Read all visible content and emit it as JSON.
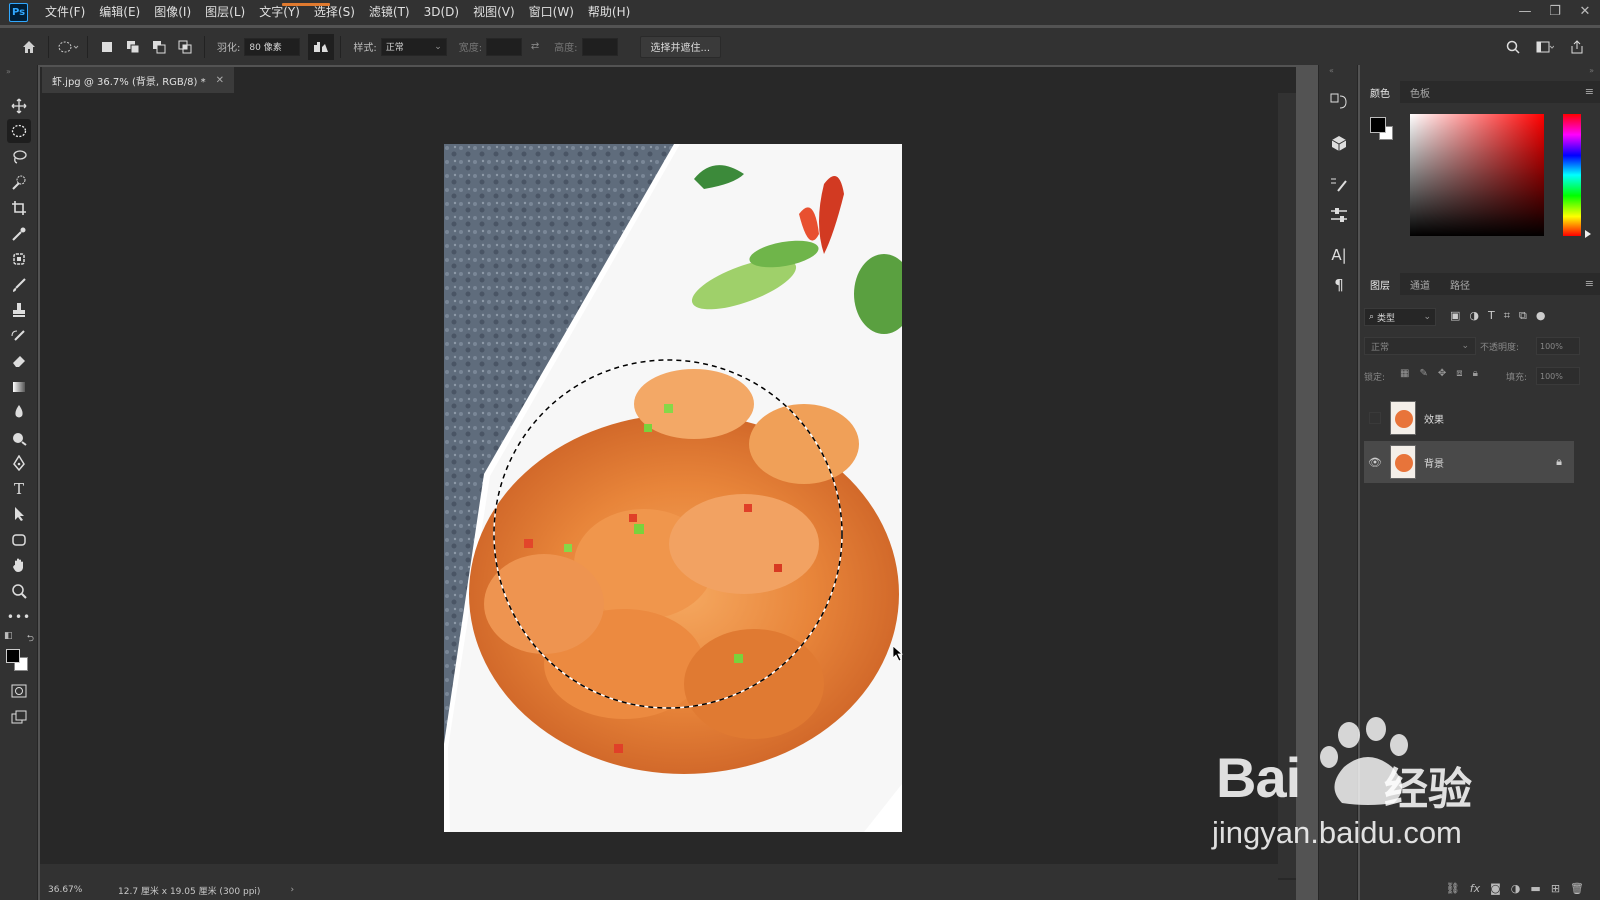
{
  "app": {
    "logo_text": "Ps"
  },
  "menu": [
    "文件(F)",
    "编辑(E)",
    "图像(I)",
    "图层(L)",
    "文字(Y)",
    "选择(S)",
    "滤镜(T)",
    "3D(D)",
    "视图(V)",
    "窗口(W)",
    "帮助(H)"
  ],
  "options": {
    "feather_label": "羽化:",
    "feather_value": "80 像素",
    "style_label": "样式:",
    "style_value": "正常",
    "width_label": "宽度:",
    "height_label": "高度:",
    "select_mask_button": "选择并遮住..."
  },
  "document": {
    "tab_title": "虾.jpg @ 36.7% (背景, RGB/8) *",
    "zoom": "36.67%",
    "doc_size": "12.7 厘米 x 19.05 厘米 (300 ppi)"
  },
  "color_panel": {
    "tabs": [
      "颜色",
      "色板"
    ],
    "foreground": "#000000",
    "background": "#ffffff"
  },
  "layers_panel": {
    "tabs": [
      "图层",
      "通道",
      "路径"
    ],
    "filter_label": "类型",
    "blend_mode": "正常",
    "opacity_label": "不透明度:",
    "opacity_value": "100%",
    "lock_label": "锁定:",
    "fill_label": "填充:",
    "fill_value": "100%",
    "layers": [
      {
        "name": "效果",
        "visible": false,
        "locked": false,
        "selected": false
      },
      {
        "name": "背景",
        "visible": true,
        "locked": true,
        "selected": true
      }
    ]
  },
  "watermark": {
    "brand": "Bai",
    "brand_cn": "经验",
    "url": "jingyan.baidu.com"
  },
  "colors": {
    "ui_dark": "#323232",
    "canvas": "#282828",
    "accent": "#31a8ff"
  }
}
